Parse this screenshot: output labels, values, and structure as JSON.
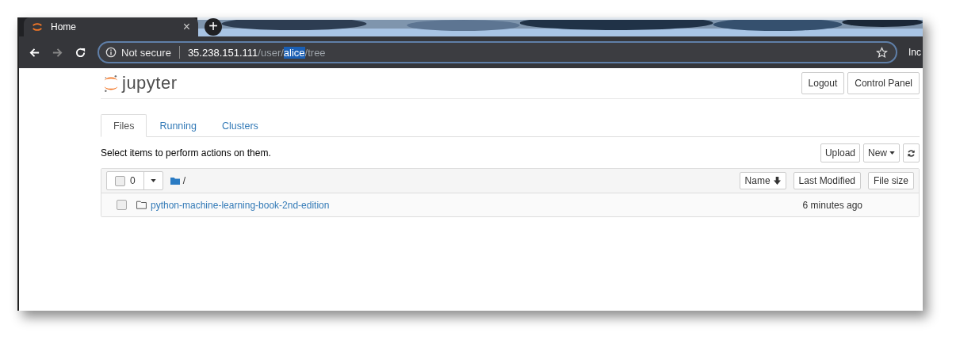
{
  "browser": {
    "tab": {
      "title": "Home",
      "close": "×"
    },
    "new_tab": "+",
    "address": {
      "security": "Not secure",
      "url_parts": [
        {
          "text": "35.238.151.111",
          "kind": "host",
          "highlighted": false
        },
        {
          "text": "/user/",
          "kind": "path",
          "highlighted": false
        },
        {
          "text": "alice",
          "kind": "path",
          "highlighted": true
        },
        {
          "text": "/tree",
          "kind": "path",
          "highlighted": false
        }
      ]
    },
    "profile": "Inc"
  },
  "header": {
    "logo": "jupyter",
    "buttons": [
      "Logout",
      "Control Panel"
    ]
  },
  "tabs": [
    {
      "label": "Files",
      "selected": true
    },
    {
      "label": "Running",
      "selected": false
    },
    {
      "label": "Clusters",
      "selected": false
    }
  ],
  "hint": "Select items to perform actions on them.",
  "toolbar": {
    "buttons": [
      "Upload",
      "New"
    ]
  },
  "list": {
    "all_checked": false,
    "selected_count": "0",
    "path": "/",
    "columns": [
      "Name",
      "Last Modified",
      "File size"
    ],
    "rows": [
      {
        "name": "python-machine-learning-book-2nd-edition",
        "modified": "6 minutes ago",
        "checked": false
      }
    ]
  }
}
